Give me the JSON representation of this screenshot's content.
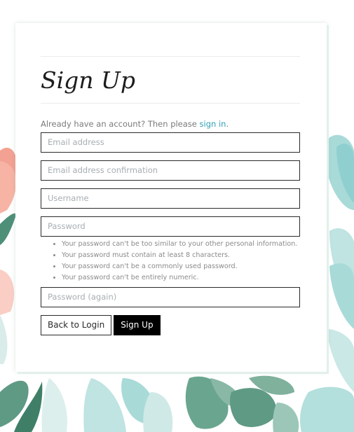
{
  "form": {
    "title": "Sign Up",
    "already_text": "Already have an account? Then please ",
    "sign_in_link": "sign in",
    "already_suffix": ".",
    "email_placeholder": "Email address",
    "email_confirm_placeholder": "Email address confirmation",
    "username_placeholder": "Username",
    "password_placeholder": "Password",
    "password_help": [
      "Your password can't be too similar to your other personal information.",
      "Your password must contain at least 8 characters.",
      "Your password can't be a commonly used password.",
      "Your password can't be entirely numeric."
    ],
    "password_again_placeholder": "Password (again)",
    "back_button": "Back to Login",
    "submit_button": "Sign Up"
  },
  "colors": {
    "link": "#2f9fb6",
    "button_primary_bg": "#000000",
    "leaf_green": "#5f9a84",
    "leaf_teal": "#8fcfcf",
    "leaf_coral": "#f2917f"
  }
}
